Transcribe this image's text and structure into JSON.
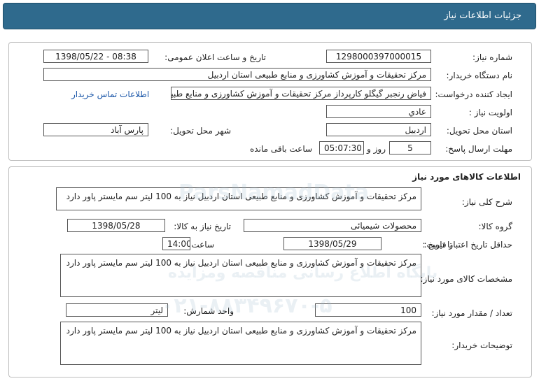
{
  "header": {
    "title": "جزئیات اطلاعات نیاز"
  },
  "info": {
    "need_number_label": "شماره نیاز:",
    "need_number": "1298000397000015",
    "announce_label": "تاریخ و ساعت اعلان عمومی:",
    "announce_value": "1398/05/22 - 08:38",
    "buyer_label": "نام دستگاه خریدار:",
    "buyer_value": "مرکز تحقیقات و آموزش کشاورزی و منابع طبیعی استان اردبیل",
    "creator_label": "ایجاد کننده درخواست:",
    "creator_value": "فیاض رنجبر گیگلو کارپرداز مرکز تحقیقات و آموزش کشاورزی و منابع طبیعی استان اردبیل",
    "contact_link": "اطلاعات تماس خریدار",
    "priority_label": "اولویت نیاز :",
    "priority_value": "عادي",
    "province_label": "استان محل تحویل:",
    "province_value": "اردبیل",
    "city_label": "شهر محل تحویل:",
    "city_value": "پارس آباد",
    "deadline_label": "مهلت ارسال پاسخ:",
    "days_value": "5",
    "days_word": "روز و",
    "time_value": "05:07:30",
    "remaining_text": "ساعت باقی مانده"
  },
  "goods": {
    "section_title": "اطلاعات کالاهای مورد نیاز",
    "desc_label": "شرح کلی نیاز:",
    "desc_value": "مرکز تحقیقات و آموزش کشاورزی و منابع طبیعی استان اردبیل نیاز به 100 لیتر سم مایستر پاور دارد",
    "group_label": "گروه کالا:",
    "group_value": "محصولات شیمیائی",
    "need_date_label": "تاریخ نیاز به کالا:",
    "need_date_value": "1398/05/28",
    "validity_label": "حداقل تاریخ اعتبار قیمت:",
    "until_label": "تا تاریخ :",
    "validity_date": "1398/05/29",
    "hour_label": "ساعت :",
    "validity_time": "14:00",
    "spec_label": "مشخصات کالای مورد نیاز:",
    "spec_value": "مرکز تحقیقات و آموزش کشاورزی و منابع طبیعی استان اردبیل نیاز به 100 لیتر سم مایستر پاور دارد",
    "qty_label": "تعداد / مقدار مورد نیاز:",
    "qty_value": "100",
    "unit_label": "واحد شمارش:",
    "unit_value": "لیتر",
    "buyer_notes_label": "توضیحات خریدار:",
    "buyer_notes_value": "مرکز تحقیقات و آموزش کشاورزی و منابع طبیعی استان اردبیل نیاز به 100 لیتر سم مایستر پاور دارد"
  },
  "watermark": {
    "brand": "ParsNamadData",
    "line1": "پایگاه اطلاع رسانی مناقصه ومزایده",
    "phone": "۰۲۱-۸۸۳۴۹۶۷۰-۵"
  }
}
